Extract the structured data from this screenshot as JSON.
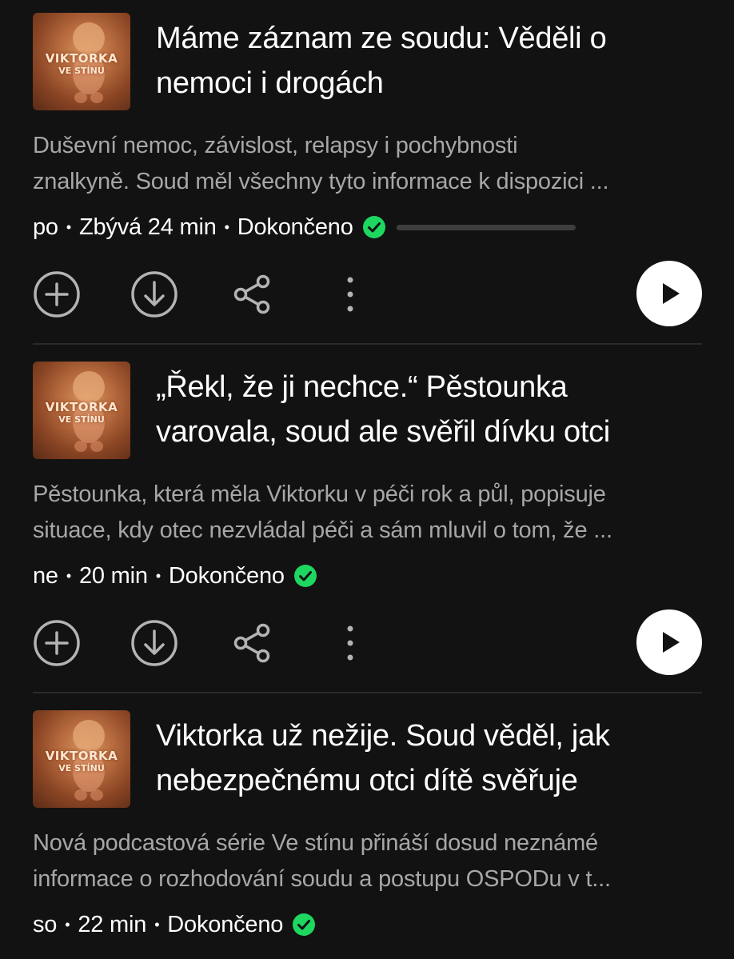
{
  "episodes": [
    {
      "cover": {
        "line1": "VIKTORKA",
        "line2": "VE STÍNU"
      },
      "title_lines": [
        "Máme záznam ze soudu: Věděli o",
        "nemoci i drogách"
      ],
      "desc_lines": [
        "Duševní nemoc, závislost, relapsy i pochybnosti",
        "znalkyně. Soud měl všechny tyto informace k dispozici ..."
      ],
      "day": "po",
      "duration": "Zbývá 24 min",
      "status": "Dokončeno",
      "has_progress": true
    },
    {
      "cover": {
        "line1": "VIKTORKA",
        "line2": "VE STÍNU"
      },
      "title_lines": [
        "„Řekl, že ji nechce.“ Pěstounka",
        "varovala, soud ale svěřil dívku otci"
      ],
      "desc_lines": [
        "Pěstounka, která měla Viktorku v péči rok a půl, popisuje",
        "situace, kdy otec nezvládal péči a sám mluvil o tom, že ..."
      ],
      "day": "ne",
      "duration": "20 min",
      "status": "Dokončeno",
      "has_progress": false
    },
    {
      "cover": {
        "line1": "VIKTORKA",
        "line2": "VE STÍNU"
      },
      "title_lines": [
        "Viktorka už nežije. Soud věděl, jak",
        "nebezpečnému otci dítě svěřuje"
      ],
      "desc_lines": [
        "Nová podcastová série Ve stínu přináší dosud neznámé",
        "informace o rozhodování soudu a postupu OSPODu v t..."
      ],
      "day": "so",
      "duration": "22 min",
      "status": "Dokončeno",
      "has_progress": false
    }
  ],
  "colors": {
    "background": "#121212",
    "secondary_text": "#a7a7a7",
    "accent_green": "#1ed760",
    "icon_gray": "#b3b3b3"
  },
  "icons": [
    "add-icon",
    "download-icon",
    "share-icon",
    "more-icon",
    "play-icon",
    "check-icon"
  ]
}
